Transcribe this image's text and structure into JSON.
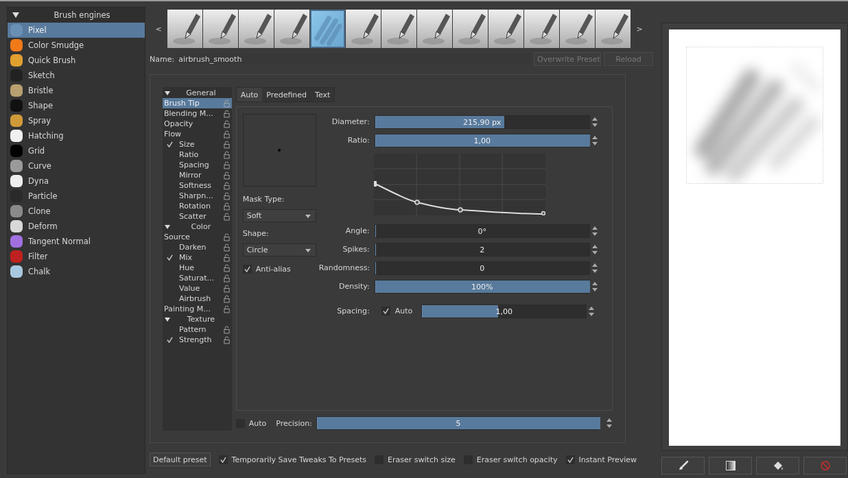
{
  "engines": {
    "title": "Brush engines",
    "expanded": true,
    "items": [
      {
        "label": "Pixel",
        "selected": true,
        "color": "#6a8fb5"
      },
      {
        "label": "Color Smudge",
        "selected": false,
        "color": "#f07a1a"
      },
      {
        "label": "Quick Brush",
        "selected": false,
        "color": "#e0a030"
      },
      {
        "label": "Sketch",
        "selected": false,
        "color": "#222222"
      },
      {
        "label": "Bristle",
        "selected": false,
        "color": "#b8a070"
      },
      {
        "label": "Shape",
        "selected": false,
        "color": "#111111"
      },
      {
        "label": "Spray",
        "selected": false,
        "color": "#d09a3a"
      },
      {
        "label": "Hatching",
        "selected": false,
        "color": "#f0f0f0"
      },
      {
        "label": "Grid",
        "selected": false,
        "color": "#000000"
      },
      {
        "label": "Curve",
        "selected": false,
        "color": "#9a9a9a"
      },
      {
        "label": "Dyna",
        "selected": false,
        "color": "#eeeeee"
      },
      {
        "label": "Particle",
        "selected": false,
        "color": "#2a2a2a"
      },
      {
        "label": "Clone",
        "selected": false,
        "color": "#8a8a8a"
      },
      {
        "label": "Deform",
        "selected": false,
        "color": "#d8d8d8"
      },
      {
        "label": "Tangent Normal",
        "selected": false,
        "color": "#a070e0"
      },
      {
        "label": "Filter",
        "selected": false,
        "color": "#c02020"
      },
      {
        "label": "Chalk",
        "selected": false,
        "color": "#a8c8e0"
      }
    ]
  },
  "presets": {
    "prev": "<",
    "next": ">",
    "items": [
      {
        "selected": false
      },
      {
        "selected": false
      },
      {
        "selected": false
      },
      {
        "selected": false
      },
      {
        "selected": true
      },
      {
        "selected": false
      },
      {
        "selected": false
      },
      {
        "selected": false
      },
      {
        "selected": false
      },
      {
        "selected": false
      },
      {
        "selected": false
      },
      {
        "selected": false
      },
      {
        "selected": false
      }
    ]
  },
  "name_row": {
    "label": "Name:",
    "value": "airbrush_smooth",
    "buttons": [
      {
        "label": "Overwrite Preset",
        "disabled": true
      },
      {
        "label": "Reload",
        "disabled": true
      }
    ]
  },
  "options": [
    {
      "label": "General",
      "expanded": true,
      "children": [
        {
          "label": "Brush Tip",
          "kind": "option",
          "selected": true
        },
        {
          "label": "Blending M...",
          "kind": "option",
          "selected": false
        },
        {
          "label": "Opacity",
          "kind": "option",
          "selected": false
        },
        {
          "label": "Flow",
          "kind": "option",
          "selected": false
        },
        {
          "label": "Size",
          "kind": "sensor",
          "checked": true,
          "selected": false
        },
        {
          "label": "Ratio",
          "kind": "sensor",
          "checked": false,
          "selected": false
        },
        {
          "label": "Spacing",
          "kind": "sensor",
          "checked": false,
          "selected": false
        },
        {
          "label": "Mirror",
          "kind": "sensor",
          "checked": false,
          "selected": false
        },
        {
          "label": "Softness",
          "kind": "sensor",
          "checked": false,
          "selected": false
        },
        {
          "label": "Sharpn...",
          "kind": "sensor",
          "checked": false,
          "selected": false
        },
        {
          "label": "Rotation",
          "kind": "sensor",
          "checked": false,
          "selected": false
        },
        {
          "label": "Scatter",
          "kind": "sensor",
          "checked": false,
          "selected": false
        }
      ]
    },
    {
      "label": "Color",
      "expanded": true,
      "children": [
        {
          "label": "Source",
          "kind": "option",
          "selected": false
        },
        {
          "label": "Darken",
          "kind": "sensor",
          "checked": false,
          "selected": false
        },
        {
          "label": "Mix",
          "kind": "sensor",
          "checked": true,
          "selected": false
        },
        {
          "label": "Hue",
          "kind": "sensor",
          "checked": false,
          "selected": false
        },
        {
          "label": "Saturat...",
          "kind": "sensor",
          "checked": false,
          "selected": false
        },
        {
          "label": "Value",
          "kind": "sensor",
          "checked": false,
          "selected": false
        },
        {
          "label": "Airbrush",
          "kind": "sensor",
          "checked": false,
          "selected": false
        },
        {
          "label": "Painting M...",
          "kind": "option",
          "selected": false
        }
      ]
    },
    {
      "label": "Texture",
      "expanded": true,
      "children": [
        {
          "label": "Pattern",
          "kind": "sensor",
          "checked": false,
          "selected": false
        },
        {
          "label": "Strength",
          "kind": "sensor",
          "checked": true,
          "selected": false
        }
      ]
    }
  ],
  "tabs": [
    {
      "label": "Auto",
      "selected": true
    },
    {
      "label": "Predefined",
      "selected": false
    },
    {
      "label": "Text",
      "selected": false
    }
  ],
  "tip": {
    "mask_type_label": "Mask Type:",
    "mask_type": "Soft",
    "shape_label": "Shape:",
    "shape": "Circle",
    "antialias": {
      "label": "Anti-alias",
      "checked": true
    },
    "sliders_top": [
      {
        "label": "Diameter:",
        "value": "215,90 px",
        "level": 0.6
      },
      {
        "label": "Ratio:",
        "value": "1,00",
        "level": 1
      }
    ],
    "sliders": [
      {
        "label": "Angle:",
        "value": "0°",
        "level": 0
      },
      {
        "label": "Spikes:",
        "value": "2",
        "level": 0
      },
      {
        "label": "Randomness:",
        "value": "0",
        "level": 0
      },
      {
        "label": "Density:",
        "value": "100%",
        "level": 1
      }
    ],
    "spacing": {
      "label": "Spacing:",
      "auto_label": "Auto",
      "auto_checked": true,
      "value": "1,00",
      "level": 0.46
    }
  },
  "precision": {
    "auto_label": "Auto",
    "auto_checked": false,
    "label": "Precision:",
    "value": "5",
    "level": 1
  },
  "bottom": {
    "default_button": "Default preset",
    "checks": [
      {
        "label": "Temporarily Save Tweaks To Presets",
        "checked": true
      },
      {
        "label": "Eraser switch size",
        "checked": false
      },
      {
        "label": "Eraser switch opacity",
        "checked": false
      },
      {
        "label": "Instant Preview",
        "checked": true
      }
    ]
  }
}
